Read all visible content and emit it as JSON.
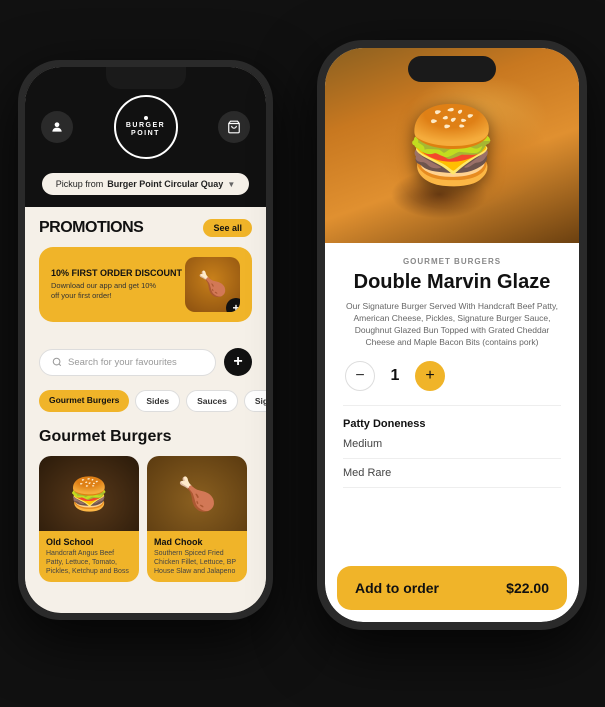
{
  "left_phone": {
    "header": {
      "user_icon": "👤",
      "cart_icon": "🛒",
      "logo_line1": "BURGER",
      "logo_line2": "POINT"
    },
    "pickup": {
      "label": "Pickup from",
      "location": "Burger Point Circular Quay",
      "arrow": "▼"
    },
    "promotions": {
      "title": "PROMOTIONS",
      "see_all": "See all",
      "card": {
        "heading": "10% FIRST ORDER DISCOUNT",
        "description": "Download our app and get 10% off your first order!"
      }
    },
    "search": {
      "placeholder": "Search for your favourites",
      "search_icon": "🔍"
    },
    "categories": [
      {
        "label": "Gourmet Burgers",
        "active": true
      },
      {
        "label": "Sides",
        "active": false
      },
      {
        "label": "Sauces",
        "active": false
      },
      {
        "label": "Signature",
        "active": false
      }
    ],
    "section_title": "Gourmet Burgers",
    "burgers": [
      {
        "name": "Old School",
        "description": "Handcraft Angus Beef Patty, Lettuce, Tomato, Pickles, Ketchup and Boss"
      },
      {
        "name": "Mad Chook",
        "description": "Southern Spiced Fried Chicken Fillet, Lettuce, BP House Slaw and Jalapeno"
      }
    ]
  },
  "right_phone": {
    "category": "GOURMET BURGERS",
    "product_name": "Double Marvin Glaze",
    "description": "Our Signature Burger Served With Handcraft Beef Patty, American Cheese, Pickles, Signature Burger Sauce, Doughnut Glazed Bun Topped with Grated Cheddar Cheese and Maple Bacon Bits (contains pork)",
    "quantity": 1,
    "quantity_minus": "−",
    "quantity_plus": "+",
    "options": {
      "section_label": "Patty Doneness",
      "items": [
        "Medium",
        "Med Rare"
      ]
    },
    "add_to_order": {
      "label": "Add to order",
      "price": "$22.00"
    }
  }
}
